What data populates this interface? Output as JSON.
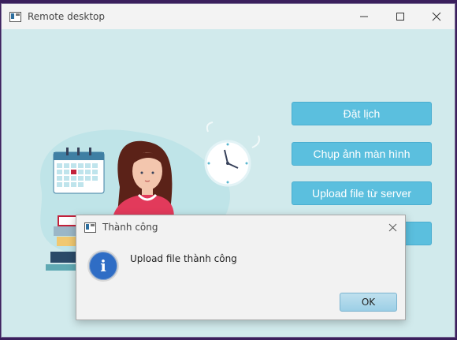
{
  "window": {
    "title": "Remote desktop",
    "controls": [
      "minimize-icon",
      "maximize-icon",
      "close-icon"
    ]
  },
  "menu_buttons": [
    {
      "label": "Đặt lịch"
    },
    {
      "label": "Chụp ảnh màn hình"
    },
    {
      "label": "Upload file từ server"
    },
    {
      "label": ""
    }
  ],
  "dialog": {
    "title": "Thành công",
    "message": "Upload file thành công",
    "ok_label": "OK",
    "icon": "info-icon"
  },
  "colors": {
    "accent": "#5bbfde",
    "background": "#d1eaec",
    "info_blue": "#2f6dc5"
  }
}
